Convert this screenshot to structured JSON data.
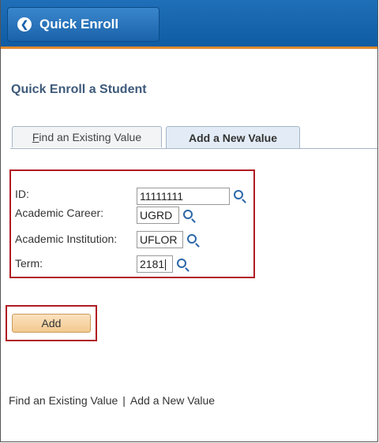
{
  "header": {
    "back_label": "Quick Enroll",
    "back_icon": "chevron-left-icon"
  },
  "page": {
    "title": "Quick Enroll a Student"
  },
  "tabs": [
    {
      "label_first": "F",
      "label_rest": "ind an Existing Value"
    },
    {
      "label": "Add a New Value"
    }
  ],
  "form": {
    "id": {
      "label": "ID:",
      "value": "11111111"
    },
    "career": {
      "label": "Academic Career:",
      "value": "UGRD"
    },
    "institution": {
      "label": "Academic Institution:",
      "value": "UFLOR"
    },
    "term": {
      "label": "Term:",
      "value": "2181"
    }
  },
  "actions": {
    "add_label": "Add"
  },
  "footer": {
    "link_find": "Find an Existing Value",
    "separator": "|",
    "link_add": "Add a New Value"
  },
  "colors": {
    "header": "#1464ab",
    "accent": "#e08a2e",
    "highlight": "#b01b23"
  }
}
